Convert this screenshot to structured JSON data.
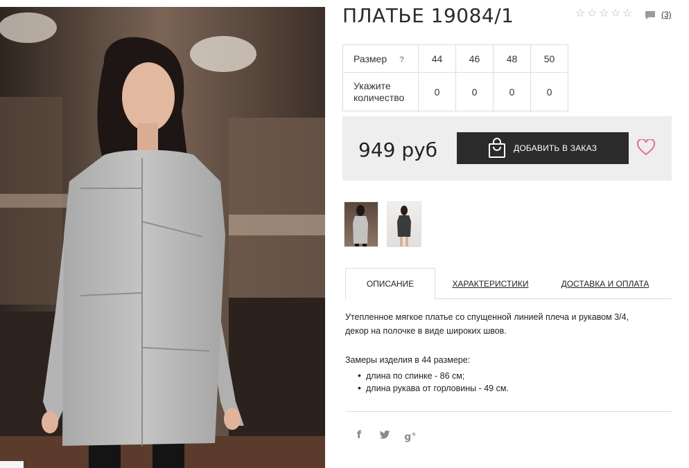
{
  "product": {
    "title": "ПЛАТЬЕ 19084/1",
    "rating_stars": 0,
    "rating_max": 5,
    "review_count": "(3)"
  },
  "size_table": {
    "size_label": "Размер",
    "help_mark": "?",
    "qty_label_line1": "Укажите",
    "qty_label_line2": "количество",
    "sizes": [
      "44",
      "46",
      "48",
      "50"
    ],
    "quantities": [
      "0",
      "0",
      "0",
      "0"
    ]
  },
  "purchase": {
    "price": "949 руб",
    "order_button": "ДОБАВИТЬ В ЗАКАЗ"
  },
  "tabs": [
    {
      "label": "ОПИСАНИЕ",
      "active": true
    },
    {
      "label": "ХАРАКТЕРИСТИКИ",
      "active": false
    },
    {
      "label": "ДОСТАВКА И ОПЛАТА",
      "active": false
    }
  ],
  "description": {
    "text_line1": "Утепленное мягкое платье со спущенной линией плеча и рукавом 3/4,",
    "text_line2": "декор на полочке в виде широких швов.",
    "measure_title": "Замеры изделия в 44 размере:",
    "measures": [
      "длина по спинке - 86 см;",
      "длина рукава от горловины - 49 см."
    ]
  },
  "icons": {
    "rating": "star-icon",
    "reviews": "comment-icon",
    "order": "shopping-bag-icon",
    "wishlist": "heart-icon",
    "social": [
      "facebook-icon",
      "twitter-icon",
      "google-plus-icon"
    ]
  },
  "colors": {
    "button_bg": "#2b2b2b",
    "heart": "#e0708a",
    "panel_bg": "#eeeeee",
    "dress": "#b8b8b8"
  }
}
